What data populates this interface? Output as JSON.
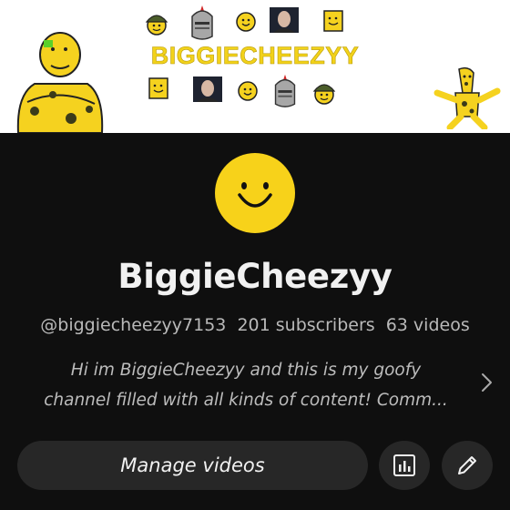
{
  "banner": {
    "title": "BIGGIECHEEZYY",
    "stickers": [
      "cheese-character",
      "army-helmet-face",
      "knight-helmet-face",
      "smiley-face",
      "man-photo",
      "cheese-block-face",
      "cheese-dancer"
    ]
  },
  "channel": {
    "name": "BiggieCheezyy",
    "handle": "@biggiecheezyy7153",
    "subscribers": "201 subscribers",
    "videos": "63 videos",
    "description_line1": "Hi im BiggieCheezyy and this is my goofy",
    "description_line2": "channel filled with all kinds of content! Comm..."
  },
  "actions": {
    "manage_label": "Manage videos",
    "analytics_icon": "analytics-icon",
    "edit_icon": "pencil-icon"
  },
  "colors": {
    "background": "#0f0f0f",
    "button": "#272727",
    "avatar": "#f7d21a",
    "banner_title": "#f2d21a"
  }
}
